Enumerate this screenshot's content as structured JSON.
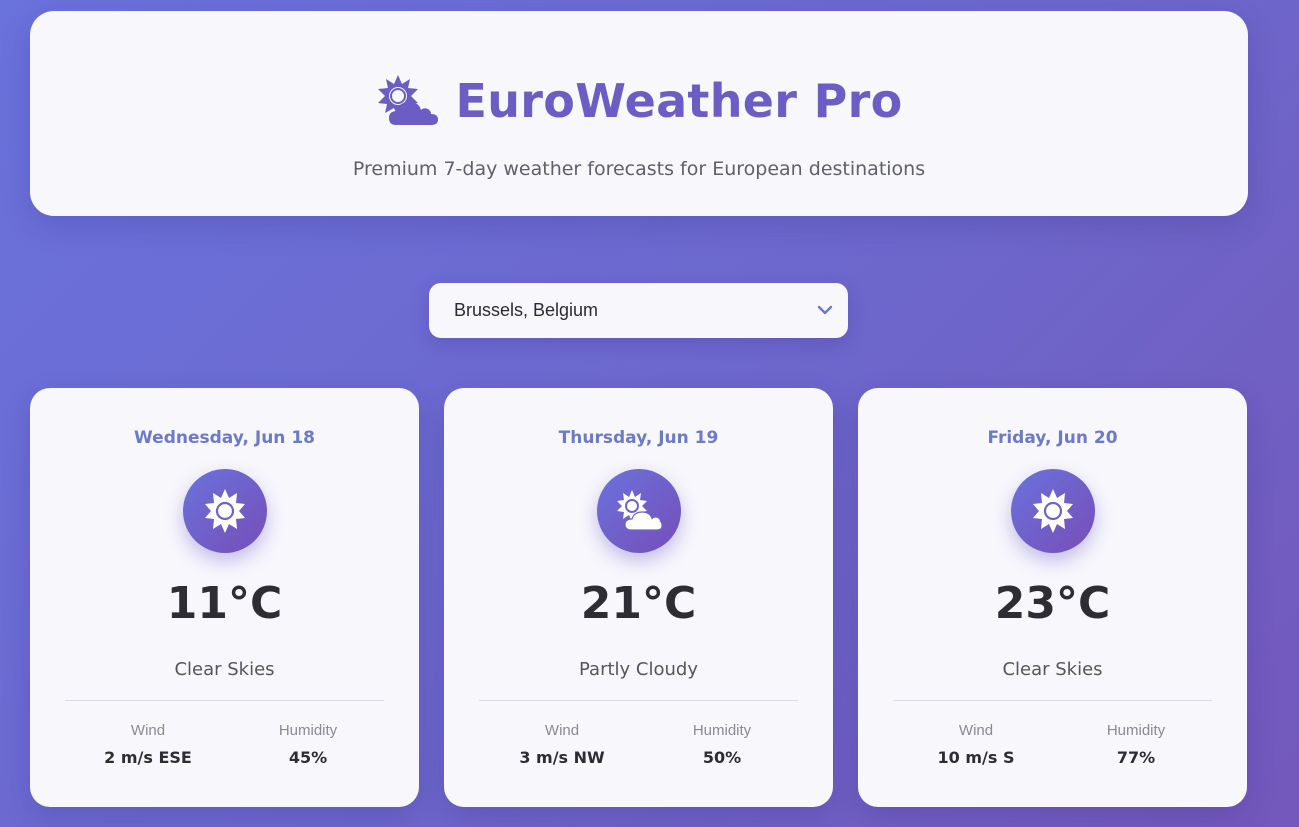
{
  "header": {
    "title": "EuroWeather Pro",
    "subtitle": "Premium 7-day weather forecasts for European destinations",
    "icon": "sun-behind-cloud-icon"
  },
  "location_select": {
    "selected": "Brussels, Belgium",
    "icon": "chevron-down-icon"
  },
  "labels": {
    "wind": "Wind",
    "humidity": "Humidity"
  },
  "forecast": [
    {
      "date": "Wednesday, Jun 18",
      "icon": "sun-icon",
      "temp": "11°C",
      "condition": "Clear Skies",
      "wind": "2 m/s ESE",
      "humidity": "45%"
    },
    {
      "date": "Thursday, Jun 19",
      "icon": "sun-behind-cloud-icon",
      "temp": "21°C",
      "condition": "Partly Cloudy",
      "wind": "3 m/s NW",
      "humidity": "50%"
    },
    {
      "date": "Friday, Jun 20",
      "icon": "sun-icon",
      "temp": "23°C",
      "condition": "Clear Skies",
      "wind": "10 m/s S",
      "humidity": "77%"
    }
  ],
  "colors": {
    "accent": "#6b5dc4",
    "date_text": "#6c7ac7",
    "background_start": "#6a72dc",
    "background_end": "#7458bb"
  }
}
